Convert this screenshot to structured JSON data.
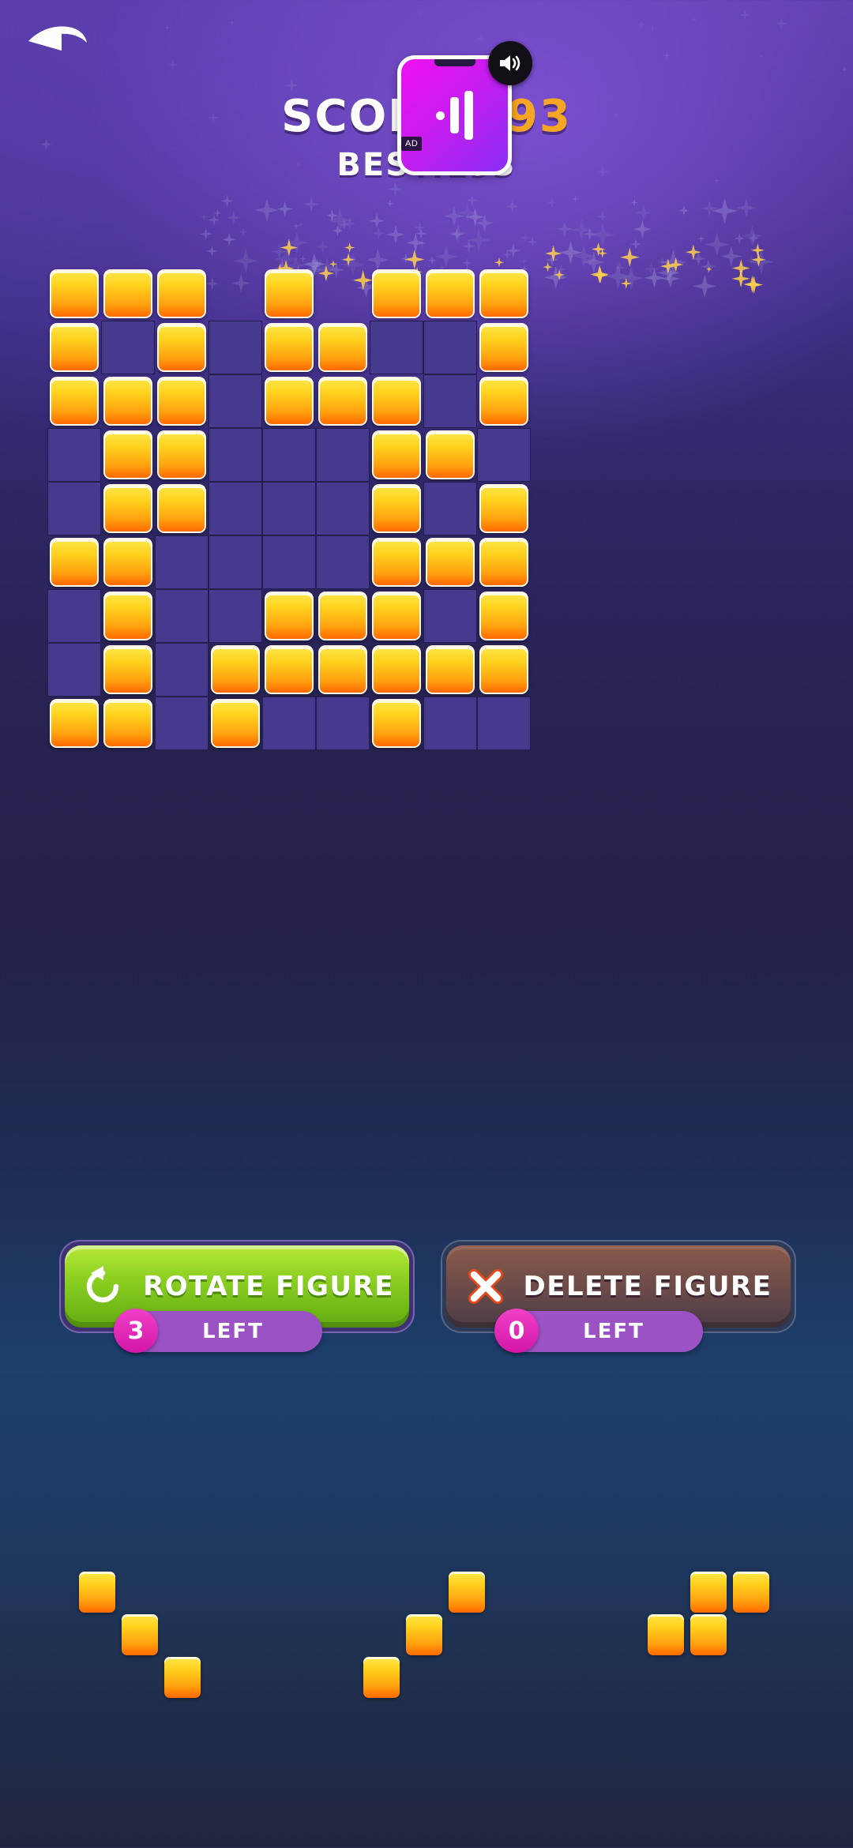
{
  "header": {
    "back_icon": "back-arrow-icon",
    "score_label": "SCORE:",
    "score_value": "193",
    "best_text": "BEST:193",
    "ad_tag": "AD",
    "ad_icon": "pause-icon",
    "sound_icon": "sound-on-icon"
  },
  "colors": {
    "score_number": "#f5a623",
    "block_top": "#ffe84a",
    "block_bottom": "#ff6a00",
    "empty_cell": "#463a8e",
    "rotate_green": "#8dd022",
    "delete_brown": "#6a4a48",
    "pill_purple": "#9b52c4",
    "badge_magenta": "#d416a8",
    "ad_magenta": "#f010f0"
  },
  "board": {
    "rows": 9,
    "cols": 9,
    "grid": [
      [
        1,
        1,
        1,
        0,
        1,
        0,
        1,
        1,
        1
      ],
      [
        1,
        0,
        1,
        0,
        1,
        1,
        0,
        0,
        1
      ],
      [
        1,
        1,
        1,
        0,
        1,
        1,
        1,
        0,
        1
      ],
      [
        0,
        1,
        1,
        0,
        0,
        0,
        1,
        1,
        0
      ],
      [
        0,
        1,
        1,
        0,
        0,
        0,
        1,
        0,
        1
      ],
      [
        1,
        1,
        0,
        0,
        0,
        0,
        1,
        1,
        1
      ],
      [
        0,
        1,
        0,
        0,
        1,
        1,
        1,
        0,
        1
      ],
      [
        0,
        1,
        0,
        1,
        1,
        1,
        1,
        1,
        1
      ],
      [
        1,
        1,
        0,
        1,
        0,
        0,
        1,
        0,
        0
      ]
    ]
  },
  "controls": {
    "rotate": {
      "label": "ROTATE FIGURE",
      "icon": "rotate-ccw-icon",
      "count": "3",
      "count_label": "LEFT"
    },
    "delete": {
      "label": "DELETE FIGURE",
      "icon": "cross-icon",
      "count": "0",
      "count_label": "LEFT"
    }
  },
  "tray": {
    "pieces": [
      {
        "name": "piece-s-descending-left",
        "cells": [
          [
            0,
            0
          ],
          [
            1,
            1
          ],
          [
            2,
            2
          ]
        ]
      },
      {
        "name": "piece-s-descending-middle",
        "cells": [
          [
            0,
            2
          ],
          [
            1,
            1
          ],
          [
            2,
            0
          ]
        ]
      },
      {
        "name": "piece-p-cluster-right",
        "cells": [
          [
            0,
            1
          ],
          [
            0,
            2
          ],
          [
            1,
            0
          ],
          [
            1,
            1
          ]
        ]
      }
    ]
  }
}
